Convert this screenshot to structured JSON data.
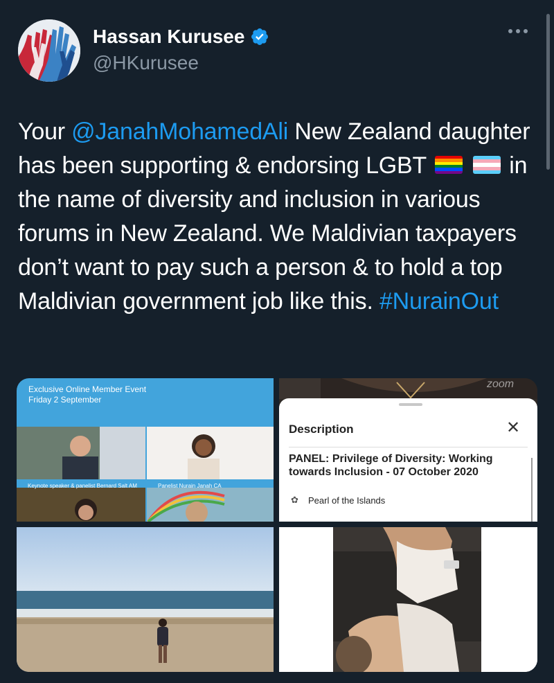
{
  "author": {
    "name": "Hassan Kurusee",
    "handle": "@HKurusee",
    "verified": true,
    "avatar_icon": "raised-hands-avatar"
  },
  "menu_icon": "more-horizontal-icon",
  "tweet": {
    "part1": "Your ",
    "mention": "@JanahMohamedAli",
    "part2": " New Zealand daughter has been supporting & endorsing LGBT ",
    "part3": " in the name of diversity and inclusion in various forums in New Zealand. We Maldivian taxpayers don’t want to pay such a person & to hold a top Maldivian government job like this. ",
    "hashtag": "#NurainOut",
    "emoji": [
      "rainbow-flag",
      "transgender-flag"
    ]
  },
  "colors": {
    "background": "#15202b",
    "link": "#1d9bf0",
    "muted": "#8b98a5",
    "verified": "#1d9bf0"
  },
  "media": {
    "event": {
      "title": "Exclusive Online Member Event",
      "date": "Friday 2 September",
      "caption_left": "Keynote speaker & panelist Bernard Salt AM",
      "caption_right": "Panelist Nurain Janah CA"
    },
    "description_sheet": {
      "title": "Description",
      "panel": "PANEL: Privilege of Diversity: Working towards Inclusion - 07 October 2020",
      "organizer": "Pearl of the Islands",
      "watermark": "zoom"
    }
  }
}
